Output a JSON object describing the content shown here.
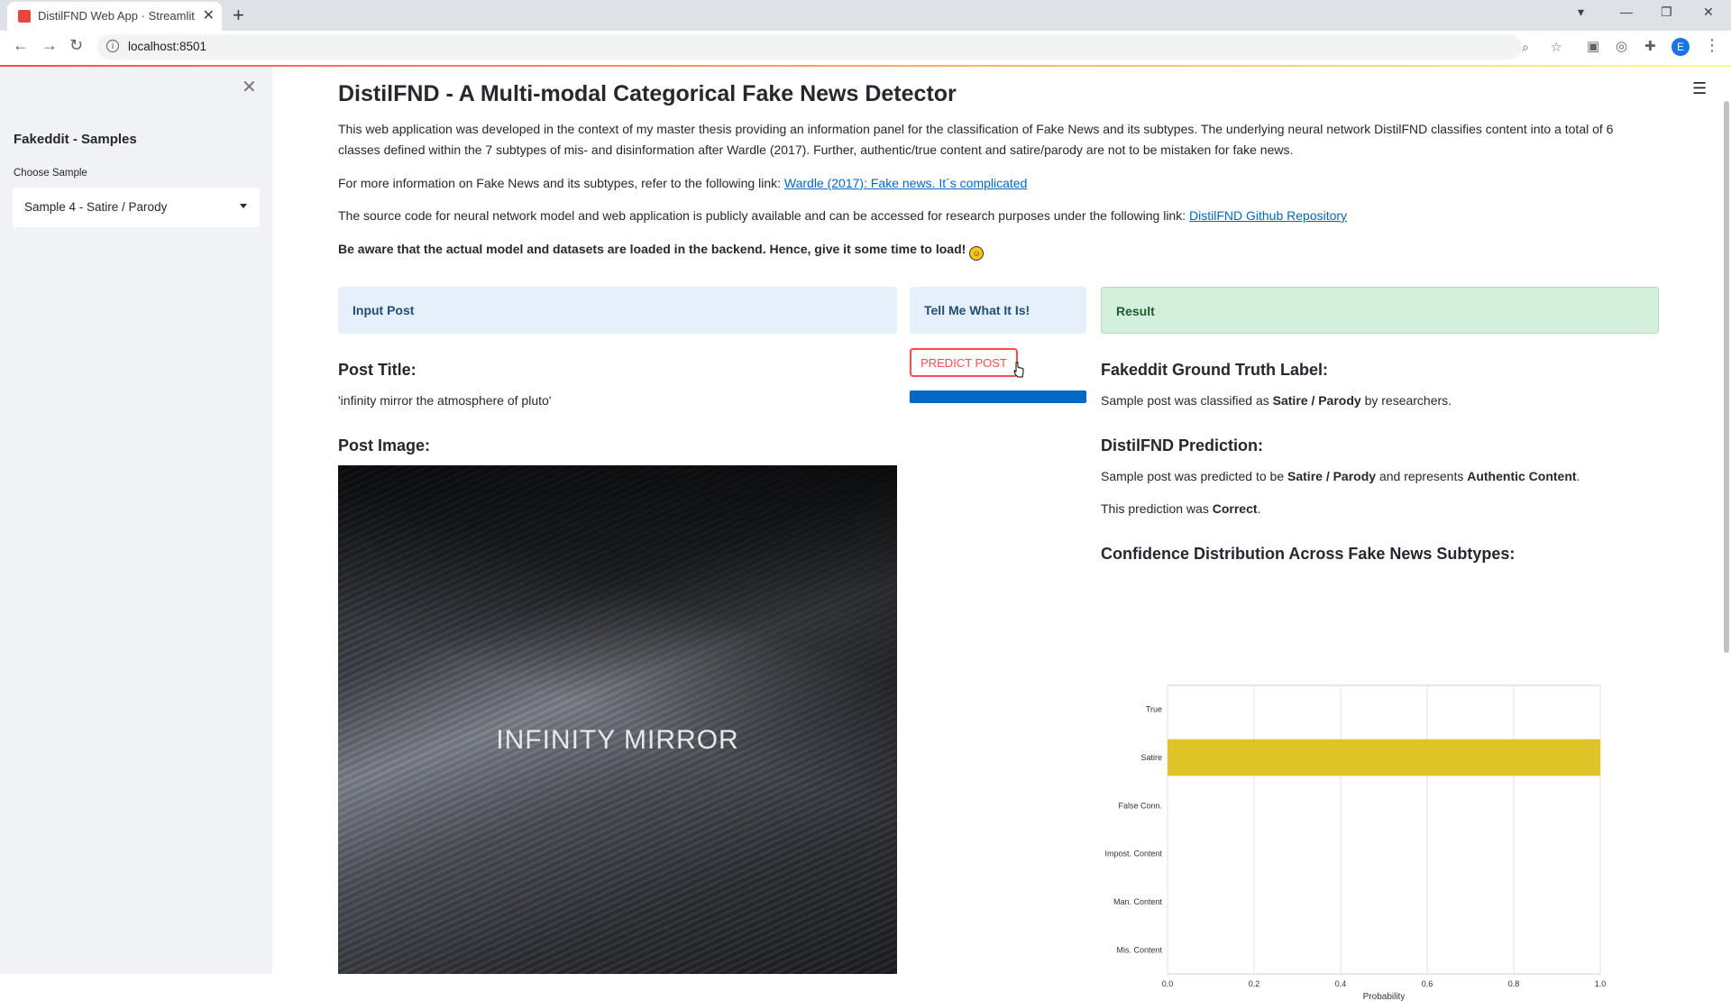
{
  "browser": {
    "tab_title": "DistilFND Web App · Streamlit",
    "url": "localhost:8501",
    "profile_initial": "E"
  },
  "sidebar": {
    "title": "Fakeddit - Samples",
    "select_label": "Choose Sample",
    "select_value": "Sample 4 - Satire / Parody"
  },
  "main": {
    "title": "DistilFND - A Multi-modal Categorical Fake News Detector",
    "intro": "This web application was developed in the context of my master thesis providing an information panel for the classification of Fake News and its subtypes. The underlying neural network DistilFND classifies content into a total of 6 classes defined within the 7 subtypes of mis- and disinformation after Wardle (2017). Further, authentic/true content and satire/parody are not to be mistaken for fake news.",
    "info_prefix": "For more information on Fake News and its subtypes, refer to the following link: ",
    "info_link": "Wardle (2017): Fake news. It´s complicated",
    "source_prefix": "The source code for neural network model and web application is publicly available and can be accessed for research purposes under the following link: ",
    "source_link": "DistilFND Github Repository",
    "warning": "Be aware that the actual model and datasets are loaded in the backend. Hence, give it some time to load!"
  },
  "panels": {
    "input": "Input Post",
    "tell": "Tell Me What It Is!",
    "result": "Result"
  },
  "post": {
    "title_heading": "Post Title:",
    "title_value": "'infinity mirror the atmosphere of pluto'",
    "image_heading": "Post Image:",
    "image_caption": "INFINITY MIRROR"
  },
  "predict": {
    "button_label": "PREDICT POST",
    "progress": 1.0
  },
  "result": {
    "gt_heading": "Fakeddit Ground Truth Label:",
    "gt_prefix": "Sample post was classified as ",
    "gt_label": "Satire / Parody",
    "gt_suffix": " by researchers.",
    "pred_heading": "DistilFND Prediction:",
    "pred_prefix": "Sample post was predicted to be ",
    "pred_label": "Satire / Parody",
    "pred_mid": " and represents ",
    "pred_category": "Authentic Content",
    "pred_end": ".",
    "correct_prefix": "This prediction was ",
    "correct_value": "Correct",
    "correct_end": ".",
    "conf_heading": "Confidence Distribution Across Fake News Subtypes:"
  },
  "chart_data": {
    "type": "bar",
    "orientation": "horizontal",
    "categories": [
      "True",
      "Satire",
      "False Conn.",
      "Impost. Content",
      "Man. Content",
      "Mis. Content"
    ],
    "values": [
      0.0,
      1.0,
      0.0,
      0.0,
      0.0,
      0.0
    ],
    "xlabel": "Probability",
    "xlim": [
      0.0,
      1.0
    ],
    "xticks": [
      "0.0",
      "0.2",
      "0.4",
      "0.6",
      "0.8",
      "1.0"
    ],
    "bar_color": "#dfc427",
    "grid": true
  }
}
